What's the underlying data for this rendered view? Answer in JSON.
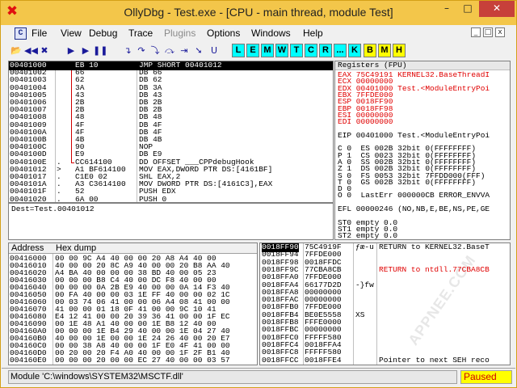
{
  "window": {
    "title": "OllyDbg - Test.exe - [CPU - main thread, module Test]",
    "icon_glyph": "✖",
    "min_glyph": "–",
    "max_glyph": "□",
    "close_glyph": "✕"
  },
  "menu": {
    "mdi_icon": "C",
    "items": [
      "File",
      "View",
      "Debug",
      "Trace",
      "Plugins",
      "Options",
      "Windows",
      "Help"
    ],
    "disabled": [
      "Plugins"
    ],
    "mdi_controls": [
      "_",
      "□",
      "x"
    ]
  },
  "toolbar": {
    "buttons": [
      {
        "name": "open-icon",
        "glyph": "📂"
      },
      {
        "name": "restart-icon",
        "glyph": "◀◀"
      },
      {
        "name": "close-program-icon",
        "glyph": "✖"
      },
      {
        "name": "run-icon",
        "glyph": "▶"
      },
      {
        "name": "run-thread-icon",
        "glyph": "▶"
      },
      {
        "name": "pause-icon",
        "glyph": "❚❚"
      },
      {
        "name": "step-into-icon",
        "glyph": "↴"
      },
      {
        "name": "step-over-icon",
        "glyph": "↷"
      },
      {
        "name": "animate-into-icon",
        "glyph": "⤵"
      },
      {
        "name": "animate-over-icon",
        "glyph": "⤼"
      },
      {
        "name": "execute-till-return-icon",
        "glyph": "⇥"
      },
      {
        "name": "go-to-icon",
        "glyph": "➘"
      },
      {
        "name": "execute-till-user-icon",
        "glyph": "U"
      }
    ],
    "letters": [
      "L",
      "E",
      "M",
      "W",
      "T",
      "C",
      "R",
      "...",
      "K",
      "B",
      "M",
      "H"
    ],
    "yellow_letters": [
      "B",
      "M",
      "H"
    ]
  },
  "disasm": {
    "rows": [
      {
        "addr": "00401000",
        "mark": "",
        "hex": "EB 10",
        "asm": "JMP SHORT 00401012",
        "selected": true
      },
      {
        "addr": "00401002",
        "mark": "",
        "hex": "66",
        "asm": "DB 66"
      },
      {
        "addr": "00401003",
        "mark": "",
        "hex": "62",
        "asm": "DB 62"
      },
      {
        "addr": "00401004",
        "mark": "",
        "hex": "3A",
        "asm": "DB 3A"
      },
      {
        "addr": "00401005",
        "mark": "",
        "hex": "43",
        "asm": "DB 43"
      },
      {
        "addr": "00401006",
        "mark": "",
        "hex": "2B",
        "asm": "DB 2B"
      },
      {
        "addr": "00401007",
        "mark": "",
        "hex": "2B",
        "asm": "DB 2B"
      },
      {
        "addr": "00401008",
        "mark": "",
        "hex": "48",
        "asm": "DB 48"
      },
      {
        "addr": "00401009",
        "mark": "",
        "hex": "4F",
        "asm": "DB 4F"
      },
      {
        "addr": "0040100A",
        "mark": "",
        "hex": "4F",
        "asm": "DB 4F"
      },
      {
        "addr": "0040100B",
        "mark": "",
        "hex": "4B",
        "asm": "DB 4B"
      },
      {
        "addr": "0040100C",
        "mark": "",
        "hex": "90",
        "asm": "NOP"
      },
      {
        "addr": "0040100D",
        "mark": "",
        "hex": "E9",
        "asm": "DB E9"
      },
      {
        "addr": "0040100E",
        "mark": ".",
        "hex": "CC614100",
        "asm": "DD OFFSET ___CPPdebugHook"
      },
      {
        "addr": "00401012",
        "mark": ">",
        "hex": "A1 BF614100",
        "asm": "MOV EAX,DWORD PTR DS:[4161BF]"
      },
      {
        "addr": "00401017",
        "mark": ".",
        "hex": "C1E0 02",
        "asm": "SHL EAX,2"
      },
      {
        "addr": "0040101A",
        "mark": ".",
        "hex": "A3 C3614100",
        "asm": "MOV DWORD PTR DS:[4161C3],EAX"
      },
      {
        "addr": "0040101F",
        "mark": ".",
        "hex": "52",
        "asm": "PUSH EDX"
      },
      {
        "addr": "00401020",
        "mark": ".",
        "hex": "6A 00",
        "asm": "PUSH 0"
      }
    ]
  },
  "info": {
    "text": "Dest=Test.00401012"
  },
  "registers": {
    "header": "Registers (FPU)",
    "lines": [
      {
        "text": "EAX 75C49191 KERNEL32.BaseThreadI",
        "red": true
      },
      {
        "text": "ECX 00000000",
        "red": true
      },
      {
        "text": "EDX 00401000 Test.<ModuleEntryPoi",
        "red": true
      },
      {
        "text": "EBX 7FFDE000",
        "red": true
      },
      {
        "text": "ESP 0018FF90",
        "red": true
      },
      {
        "text": "EBP 0018FF98",
        "red": true
      },
      {
        "text": "ESI 00000000",
        "red": true
      },
      {
        "text": "EDI 00000000",
        "red": true
      },
      {
        "text": "",
        "red": false
      },
      {
        "text": "EIP 00401000 Test.<ModuleEntryPoi",
        "red": false
      },
      {
        "text": "",
        "red": false
      },
      {
        "text": "C 0  ES 002B 32bit 0(FFFFFFFF)",
        "red": false
      },
      {
        "text": "P 1  CS 0023 32bit 0(FFFFFFFF)",
        "red": false
      },
      {
        "text": "A 0  SS 002B 32bit 0(FFFFFFFF)",
        "red": false
      },
      {
        "text": "Z 1  DS 002B 32bit 0(FFFFFFFF)",
        "red": false
      },
      {
        "text": "S 0  FS 0053 32bit 7FFDD000(FFF)",
        "red": false
      },
      {
        "text": "T 0  GS 002B 32bit 0(FFFFFFFF)",
        "red": false
      },
      {
        "text": "D 0",
        "red": false
      },
      {
        "text": "O 0  LastErr 000000CB ERROR_ENVVA",
        "red": false
      },
      {
        "text": "",
        "red": false
      },
      {
        "text": "EFL 00000246 (NO,NB,E,BE,NS,PE,GE",
        "red": false
      },
      {
        "text": "",
        "red": false
      },
      {
        "text": "ST0 empty 0.0",
        "red": false
      },
      {
        "text": "ST1 empty 0.0",
        "red": false
      },
      {
        "text": "ST2 empty 0.0",
        "red": false
      }
    ]
  },
  "dump": {
    "col_address": "Address",
    "col_hex": "Hex dump",
    "rows": [
      {
        "addr": "00416000",
        "hex": "00 00 9C A4 40 00 00 20 A8 A4 40 00"
      },
      {
        "addr": "00416010",
        "hex": "40 00 00 20 8C A9 40 00 00 20 B8 AA 40"
      },
      {
        "addr": "00416020",
        "hex": "A4 BA 40 00 00 00 38 BD 40 00 05 23"
      },
      {
        "addr": "00416030",
        "hex": "00 00 00 B8 C4 40 00 DC F8 40 00 00"
      },
      {
        "addr": "00416040",
        "hex": "00 00 00 0A 2B E9 40 00 00 0A 14 F3 40"
      },
      {
        "addr": "00416050",
        "hex": "00 FA 40 00 00 03 1E FF 40 00 00 02 1C"
      },
      {
        "addr": "00416060",
        "hex": "00 03 74 06 41 00 00 06 A4 08 41 00 00"
      },
      {
        "addr": "00416070",
        "hex": "41 00 00 01 18 0F 41 00 00 9C 10 41"
      },
      {
        "addr": "00416080",
        "hex": "E4 12 41 00 00 20 39 36 41 00 00 1F EC"
      },
      {
        "addr": "00416090",
        "hex": "00 1E 48 A1 40 00 00 1E B8 12 40 00"
      },
      {
        "addr": "004160A0",
        "hex": "00 00 00 1E B4 29 40 00 00 1E 04 27 40"
      },
      {
        "addr": "004160B0",
        "hex": "40 00 00 1E 00 00 1E 24 26 40 00 20 E7"
      },
      {
        "addr": "004160C0",
        "hex": "00 00 38 A8 40 00 00 1F E0 4F 41 00 00"
      },
      {
        "addr": "004160D0",
        "hex": "00 20 00 20 F4 A0 40 00 00 1F 2F B1 40"
      },
      {
        "addr": "004160E0",
        "hex": "00 00 00 20 00 00 EC 27 40 00 00 03 57"
      }
    ]
  },
  "stack": {
    "rows": [
      {
        "addr": "0018FF90",
        "val": "75C4919F",
        "asc": "ƒæ-u",
        "cmt": "RETURN to KERNEL32.BaseT",
        "selected": true
      },
      {
        "addr": "0018FF94",
        "val": "7FFDE000",
        "asc": "",
        "cmt": ""
      },
      {
        "addr": "0018FF98",
        "val": "0018FFDC",
        "asc": "",
        "cmt": ""
      },
      {
        "addr": "0018FF9C",
        "val": "77CBA8CB",
        "asc": "",
        "cmt": "RETURN to ntdll.77CBA8CB",
        "red": true
      },
      {
        "addr": "0018FFA0",
        "val": "7FFDE000",
        "asc": "",
        "cmt": ""
      },
      {
        "addr": "0018FFA4",
        "val": "66177D2D",
        "asc": "-}fw",
        "cmt": ""
      },
      {
        "addr": "0018FFA8",
        "val": "00000000",
        "asc": "",
        "cmt": ""
      },
      {
        "addr": "0018FFAC",
        "val": "00000000",
        "asc": "",
        "cmt": ""
      },
      {
        "addr": "0018FFB0",
        "val": "7FFDE000",
        "asc": "",
        "cmt": ""
      },
      {
        "addr": "0018FFB4",
        "val": "BE0E5558",
        "asc": "XS",
        "cmt": ""
      },
      {
        "addr": "0018FFB8",
        "val": "FFFE0000",
        "asc": "",
        "cmt": ""
      },
      {
        "addr": "0018FFBC",
        "val": "00000000",
        "asc": "",
        "cmt": ""
      },
      {
        "addr": "0018FFC0",
        "val": "FFFFF580",
        "asc": "",
        "cmt": ""
      },
      {
        "addr": "0018FFC4",
        "val": "0018FFA4",
        "asc": "",
        "cmt": ""
      },
      {
        "addr": "0018FFC8",
        "val": "FFFFF580",
        "asc": "",
        "cmt": ""
      },
      {
        "addr": "0018FFCC",
        "val": "0018FFE4",
        "asc": "",
        "cmt": "Pointer to next SEH reco"
      }
    ],
    "watermark": "APPNEE.COM"
  },
  "status": {
    "message": "Module 'C:\\windows\\SYSTEM32\\MSCTF.dll'",
    "state": "Paused"
  }
}
